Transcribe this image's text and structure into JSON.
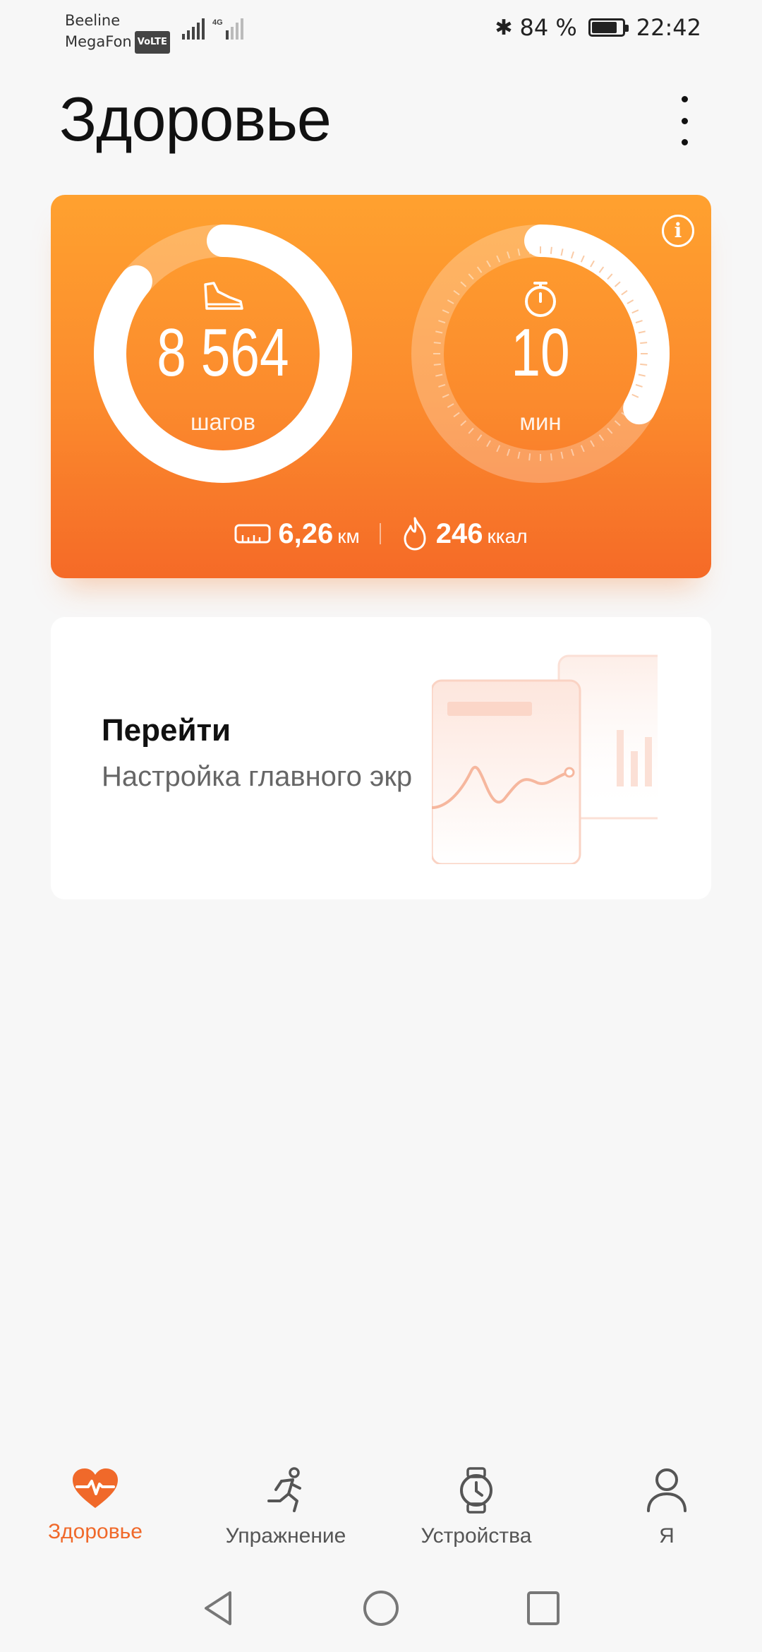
{
  "status_bar": {
    "carrier_1": "Beeline",
    "carrier_2": "MegaFon",
    "volte_badge": "VoLTE",
    "network": "4G",
    "battery": "84 %",
    "battery_level": 0.84,
    "time": "22:42"
  },
  "header": {
    "title": "Здоровье"
  },
  "activity": {
    "steps_value": "8 564",
    "steps_label": "шагов",
    "steps_progress": 0.86,
    "minutes_value": "10",
    "minutes_label": "мин",
    "minutes_progress": 0.33,
    "distance_value": "6,26",
    "distance_unit": "км",
    "calories_value": "246",
    "calories_unit": "ккал"
  },
  "goto_card": {
    "title": "Перейти",
    "subtitle": "Настройка главного экр"
  },
  "tabs": [
    {
      "label": "Здоровье",
      "icon": "heart-pulse-icon",
      "active": true
    },
    {
      "label": "Упражнение",
      "icon": "running-icon",
      "active": false
    },
    {
      "label": "Устройства",
      "icon": "watch-icon",
      "active": false
    },
    {
      "label": "Я",
      "icon": "person-icon",
      "active": false
    }
  ],
  "colors": {
    "accent": "#f0692a",
    "card_top": "#ffa12f",
    "card_bottom": "#f56a27"
  }
}
